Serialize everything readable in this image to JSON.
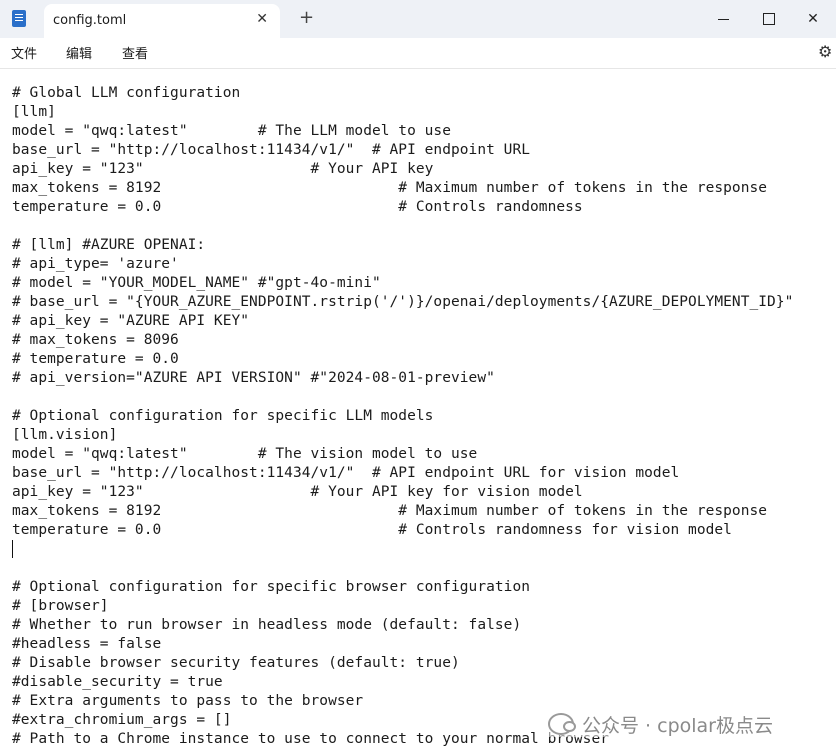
{
  "tab": {
    "title": "config.toml",
    "close": "✕",
    "new": "+"
  },
  "window": {
    "minimize": "",
    "maximize": "",
    "close": "✕"
  },
  "menu": {
    "file": "文件",
    "edit": "编辑",
    "view": "查看"
  },
  "settings_icon": "⚙",
  "editor": {
    "lines": [
      "# Global LLM configuration",
      "[llm]",
      "model = \"qwq:latest\"        # The LLM model to use",
      "base_url = \"http://localhost:11434/v1/\"  # API endpoint URL",
      "api_key = \"123\"                   # Your API key",
      "max_tokens = 8192                           # Maximum number of tokens in the response",
      "temperature = 0.0                           # Controls randomness",
      "",
      "# [llm] #AZURE OPENAI:",
      "# api_type= 'azure'",
      "# model = \"YOUR_MODEL_NAME\" #\"gpt-4o-mini\"",
      "# base_url = \"{YOUR_AZURE_ENDPOINT.rstrip('/')}/openai/deployments/{AZURE_DEPOLYMENT_ID}\"",
      "# api_key = \"AZURE API KEY\"",
      "# max_tokens = 8096",
      "# temperature = 0.0",
      "# api_version=\"AZURE API VERSION\" #\"2024-08-01-preview\"",
      "",
      "# Optional configuration for specific LLM models",
      "[llm.vision]",
      "model = \"qwq:latest\"        # The vision model to use",
      "base_url = \"http://localhost:11434/v1/\"  # API endpoint URL for vision model",
      "api_key = \"123\"                   # Your API key for vision model",
      "max_tokens = 8192                           # Maximum number of tokens in the response",
      "temperature = 0.0                           # Controls randomness for vision model",
      "",
      "",
      "# Optional configuration for specific browser configuration",
      "# [browser]",
      "# Whether to run browser in headless mode (default: false)",
      "#headless = false",
      "# Disable browser security features (default: true)",
      "#disable_security = true",
      "# Extra arguments to pass to the browser",
      "#extra_chromium_args = []",
      "# Path to a Chrome instance to use to connect to your normal browser"
    ]
  },
  "watermark": {
    "text": "公众号 · cpolar极点云"
  }
}
